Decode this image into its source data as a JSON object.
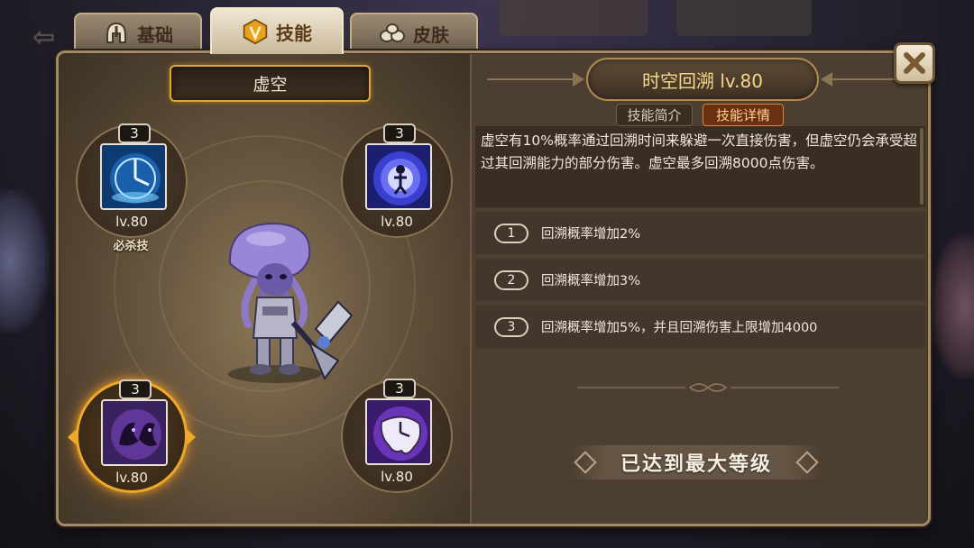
{
  "tabs": [
    {
      "label": "基础",
      "icon": "helmet-icon",
      "active": false
    },
    {
      "label": "技能",
      "icon": "skill-emblem-icon",
      "active": true
    },
    {
      "label": "皮肤",
      "icon": "clothes-icon",
      "active": false
    }
  ],
  "hero": {
    "name": "虚空",
    "portrait": "jellyfish-hero-with-drill-hammer"
  },
  "skills": [
    {
      "rank": "3",
      "level": "lv.80",
      "tag": "必杀技",
      "icon": "time-clock-vortex-icon",
      "selected": false
    },
    {
      "rank": "3",
      "level": "lv.80",
      "icon": "figure-in-portal-icon",
      "selected": false
    },
    {
      "rank": "3",
      "level": "lv.80",
      "icon": "shadow-clone-icon",
      "selected": true
    },
    {
      "rank": "3",
      "level": "lv.80",
      "icon": "melting-clock-icon",
      "selected": false
    }
  ],
  "detail": {
    "title": "时空回溯 lv.80",
    "subtabs": [
      "技能简介",
      "技能详情"
    ],
    "active_subtab": "技能详情",
    "description": "虚空有10%概率通过回溯时间来躲避一次直接伤害，但虚空仍会承受超过其回溯能力的部分伤害。虚空最多回溯8000点伤害。",
    "effects": [
      {
        "num": "1",
        "text": "回溯概率增加2%"
      },
      {
        "num": "2",
        "text": "回溯概率增加3%"
      },
      {
        "num": "3",
        "text": "回溯概率增加5%，并且回溯伤害上限增加4000"
      }
    ],
    "max_level_label": "已达到最大等级"
  },
  "colors": {
    "accent_gold": "#f0a828",
    "title_text": "#f6d78a",
    "active_subtab_bg": "#6b2f14"
  }
}
